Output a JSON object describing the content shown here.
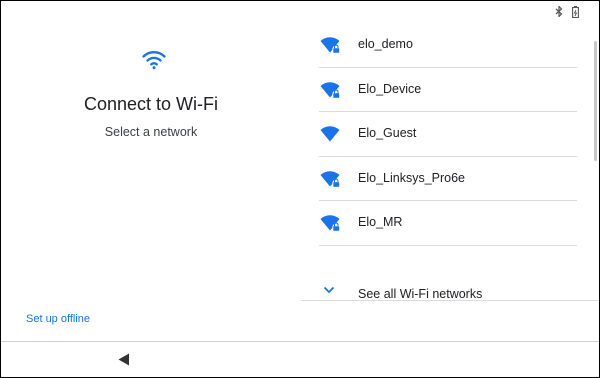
{
  "status_bar": {
    "icons": [
      "bluetooth-icon",
      "battery-icon"
    ]
  },
  "setup": {
    "icon": "wifi-icon",
    "title": "Connect to Wi-Fi",
    "subtitle": "Select a network",
    "offline_link": "Set up offline"
  },
  "networks": [
    {
      "name": "elo_demo",
      "secured": true
    },
    {
      "name": "Elo_Device",
      "secured": true
    },
    {
      "name": "Elo_Guest",
      "secured": false
    },
    {
      "name": "Elo_Linksys_Pro6e",
      "secured": true
    },
    {
      "name": "Elo_MR",
      "secured": true
    }
  ],
  "see_all": {
    "label": "See all Wi-Fi networks",
    "icon": "chevron-down-icon"
  },
  "nav": {
    "back_icon": "back-icon"
  },
  "colors": {
    "accent": "#1a73e8",
    "text": "#202124"
  }
}
